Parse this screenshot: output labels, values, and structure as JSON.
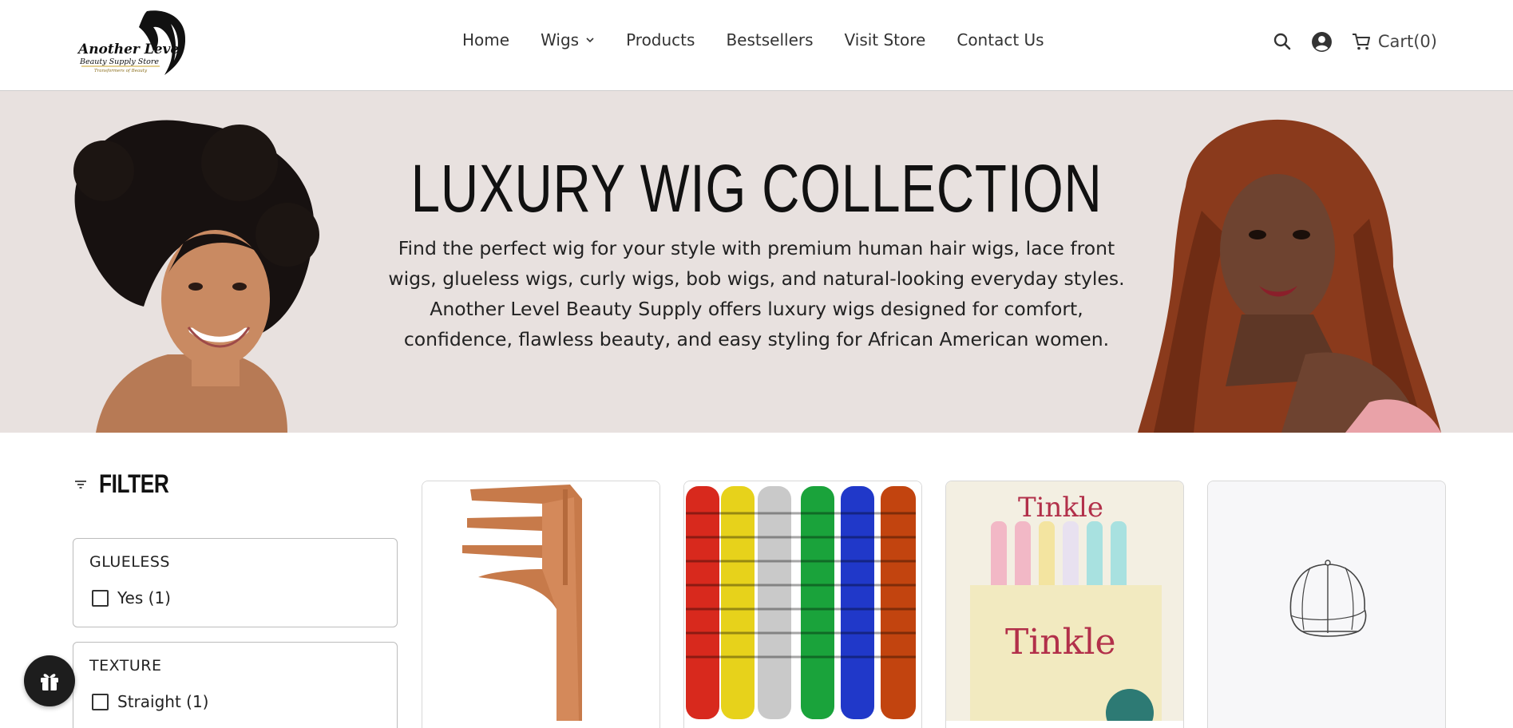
{
  "header": {
    "logo": {
      "line1": "Another Level",
      "line2": "Beauty Supply Store",
      "line3": "Transformers of Beauty"
    },
    "nav": [
      {
        "label": "Home"
      },
      {
        "label": "Wigs",
        "has_dropdown": true
      },
      {
        "label": "Products"
      },
      {
        "label": "Bestsellers"
      },
      {
        "label": "Visit Store"
      },
      {
        "label": "Contact Us"
      }
    ],
    "icons": [
      "search-icon",
      "account-icon",
      "cart-icon"
    ],
    "cart_label": "Cart(0)"
  },
  "hero": {
    "title": "LUXURY WIG COLLECTION",
    "lines": [
      "Find the perfect wig for your style with premium human hair wigs, lace front",
      "wigs, glueless wigs, curly wigs, bob wigs, and natural-looking everyday styles.",
      "Another Level Beauty Supply offers luxury wigs designed for comfort,",
      "confidence, flawless beauty, and easy styling for African American women."
    ],
    "background_color": "#e8e1df"
  },
  "filter": {
    "title": "FILTER",
    "groups": [
      {
        "title": "GLUELESS",
        "options": [
          {
            "label": "Yes (1)",
            "checked": false
          }
        ]
      },
      {
        "title": "TEXTURE",
        "options": [
          {
            "label": "Straight (1)",
            "checked": false
          }
        ]
      }
    ]
  },
  "products": [
    {
      "image": "comb-product-image"
    },
    {
      "image": "rollers-product-image"
    },
    {
      "image": "shaver-product-image"
    },
    {
      "image": "cap-placeholder-image"
    }
  ],
  "floating": {
    "icon": "gift-icon"
  }
}
